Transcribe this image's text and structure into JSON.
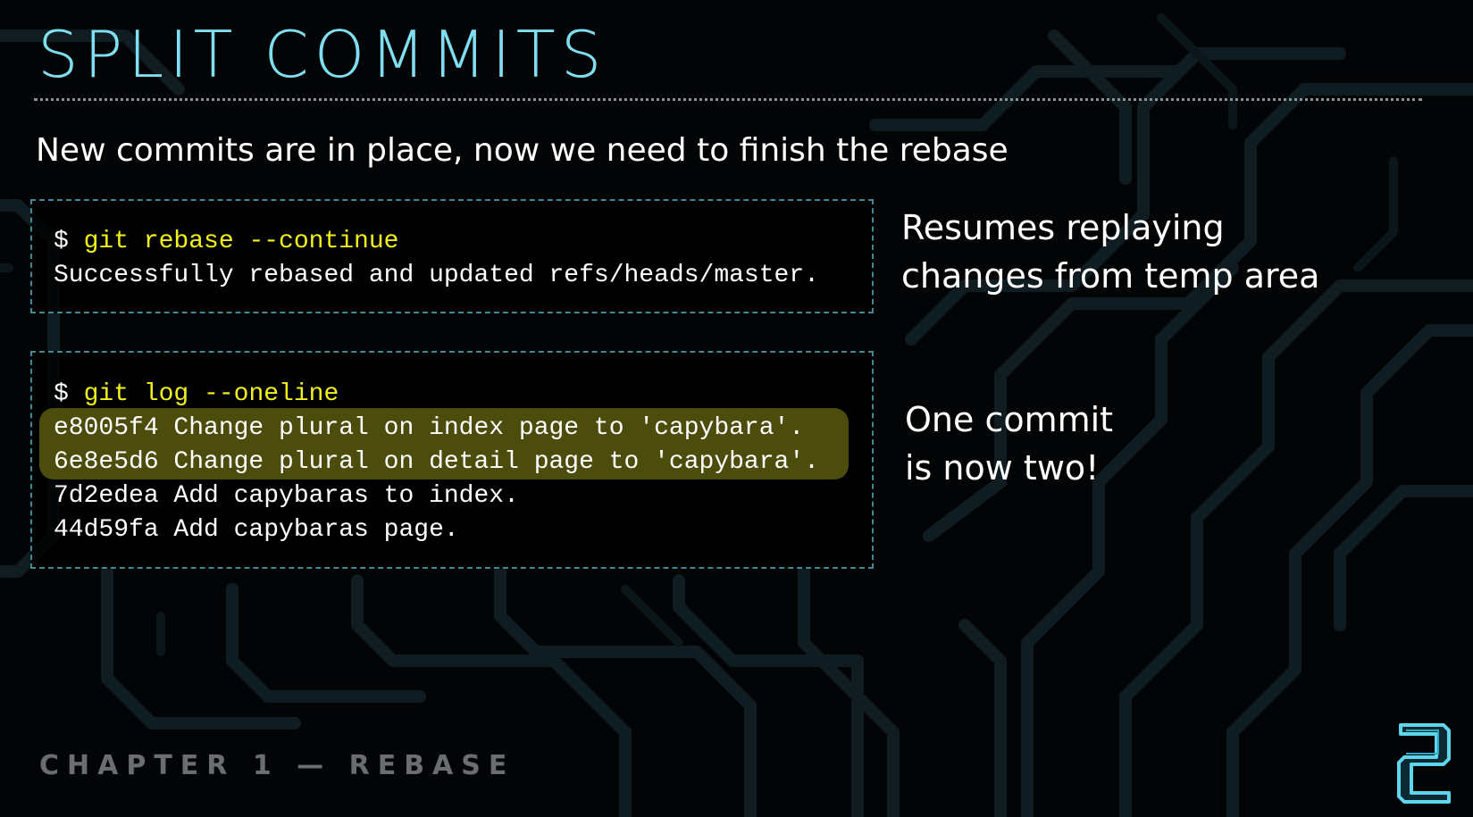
{
  "slide": {
    "title": "SPLIT COMMITS",
    "subtitle": "New commits are in place, now we need to finish the rebase",
    "footer": "CHAPTER 1 — REBASE"
  },
  "terminal_one": {
    "prompt": "$ ",
    "command": "git rebase --continue",
    "output": "Successfully rebased and updated refs/heads/master."
  },
  "terminal_two": {
    "prompt": "$ ",
    "command": "git log --oneline",
    "log_lines": [
      "e8005f4 Change plural on index page to 'capybara'.",
      "6e8e5d6 Change plural on detail page to 'capybara'.",
      "7d2edea Add capybaras to index.",
      "44d59fa Add capybaras page."
    ]
  },
  "notes": {
    "first_line1": "Resumes replaying",
    "first_line2": "changes from temp area",
    "second_line1": "One commit",
    "second_line2": "is now two!"
  },
  "colors": {
    "title": "#7fdff0",
    "command": "#f2f21a",
    "highlight": "#4c4c0c",
    "box_border": "#3f8896",
    "footer": "#6a6e71"
  },
  "icons": {
    "logo": "chapter-2-logo-icon",
    "background": "circuit-board-pattern"
  }
}
